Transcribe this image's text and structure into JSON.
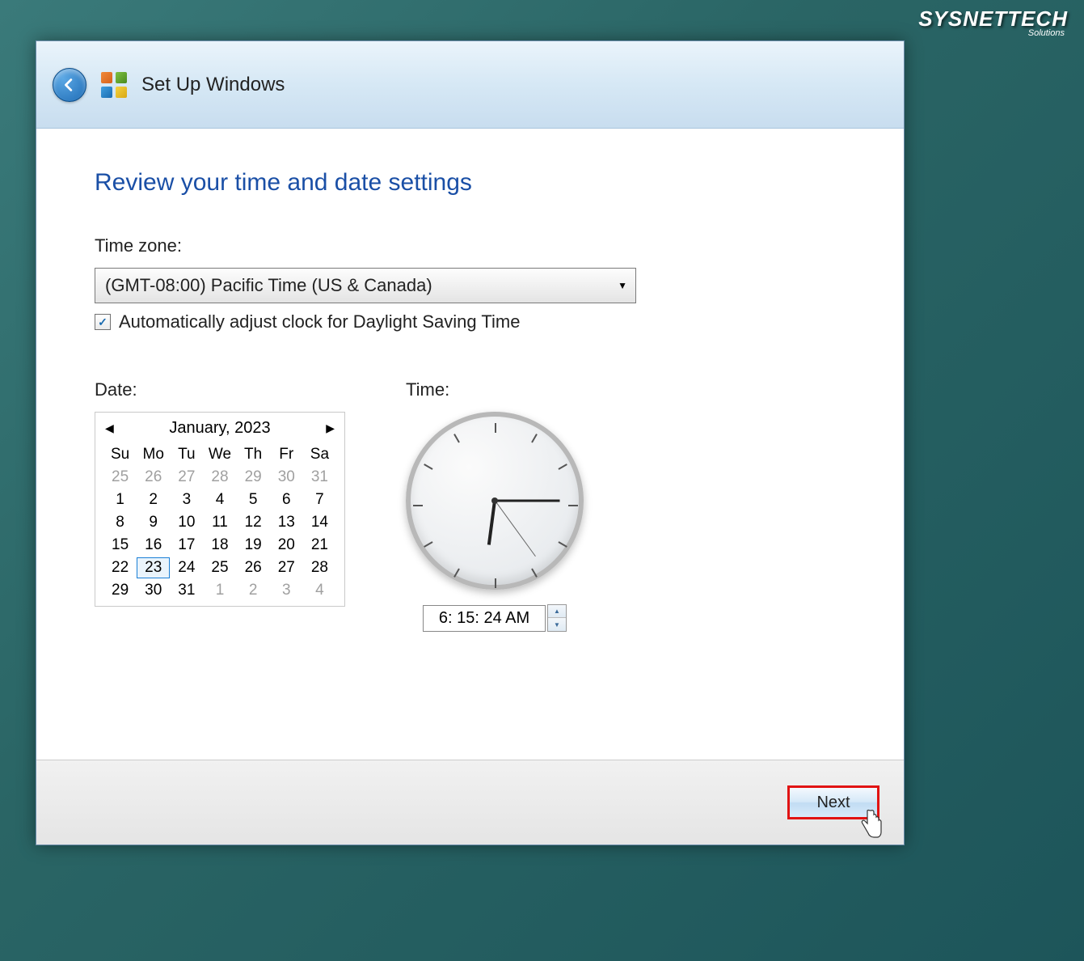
{
  "watermark": {
    "main": "SYSNETTECH",
    "sub": "Solutions"
  },
  "titlebar": {
    "title": "Set Up Windows"
  },
  "heading": "Review your time and date settings",
  "timezone": {
    "label": "Time zone:",
    "selected": "(GMT-08:00) Pacific Time (US & Canada)"
  },
  "dst": {
    "checked": true,
    "label": "Automatically adjust clock for Daylight Saving Time"
  },
  "date": {
    "label": "Date:",
    "month_title": "January, 2023",
    "day_headers": [
      "Su",
      "Mo",
      "Tu",
      "We",
      "Th",
      "Fr",
      "Sa"
    ],
    "cells": [
      {
        "d": "25",
        "other": true
      },
      {
        "d": "26",
        "other": true
      },
      {
        "d": "27",
        "other": true
      },
      {
        "d": "28",
        "other": true
      },
      {
        "d": "29",
        "other": true
      },
      {
        "d": "30",
        "other": true
      },
      {
        "d": "31",
        "other": true
      },
      {
        "d": "1"
      },
      {
        "d": "2"
      },
      {
        "d": "3"
      },
      {
        "d": "4"
      },
      {
        "d": "5"
      },
      {
        "d": "6"
      },
      {
        "d": "7"
      },
      {
        "d": "8"
      },
      {
        "d": "9"
      },
      {
        "d": "10"
      },
      {
        "d": "11"
      },
      {
        "d": "12"
      },
      {
        "d": "13"
      },
      {
        "d": "14"
      },
      {
        "d": "15"
      },
      {
        "d": "16"
      },
      {
        "d": "17"
      },
      {
        "d": "18"
      },
      {
        "d": "19"
      },
      {
        "d": "20"
      },
      {
        "d": "21"
      },
      {
        "d": "22"
      },
      {
        "d": "23",
        "selected": true
      },
      {
        "d": "24"
      },
      {
        "d": "25"
      },
      {
        "d": "26"
      },
      {
        "d": "27"
      },
      {
        "d": "28"
      },
      {
        "d": "29"
      },
      {
        "d": "30"
      },
      {
        "d": "31"
      },
      {
        "d": "1",
        "other": true
      },
      {
        "d": "2",
        "other": true
      },
      {
        "d": "3",
        "other": true
      },
      {
        "d": "4",
        "other": true
      }
    ]
  },
  "time": {
    "label": "Time:",
    "value": "6: 15: 24 AM",
    "hour": 6,
    "minute": 15,
    "second": 24
  },
  "footer": {
    "next": "Next"
  }
}
